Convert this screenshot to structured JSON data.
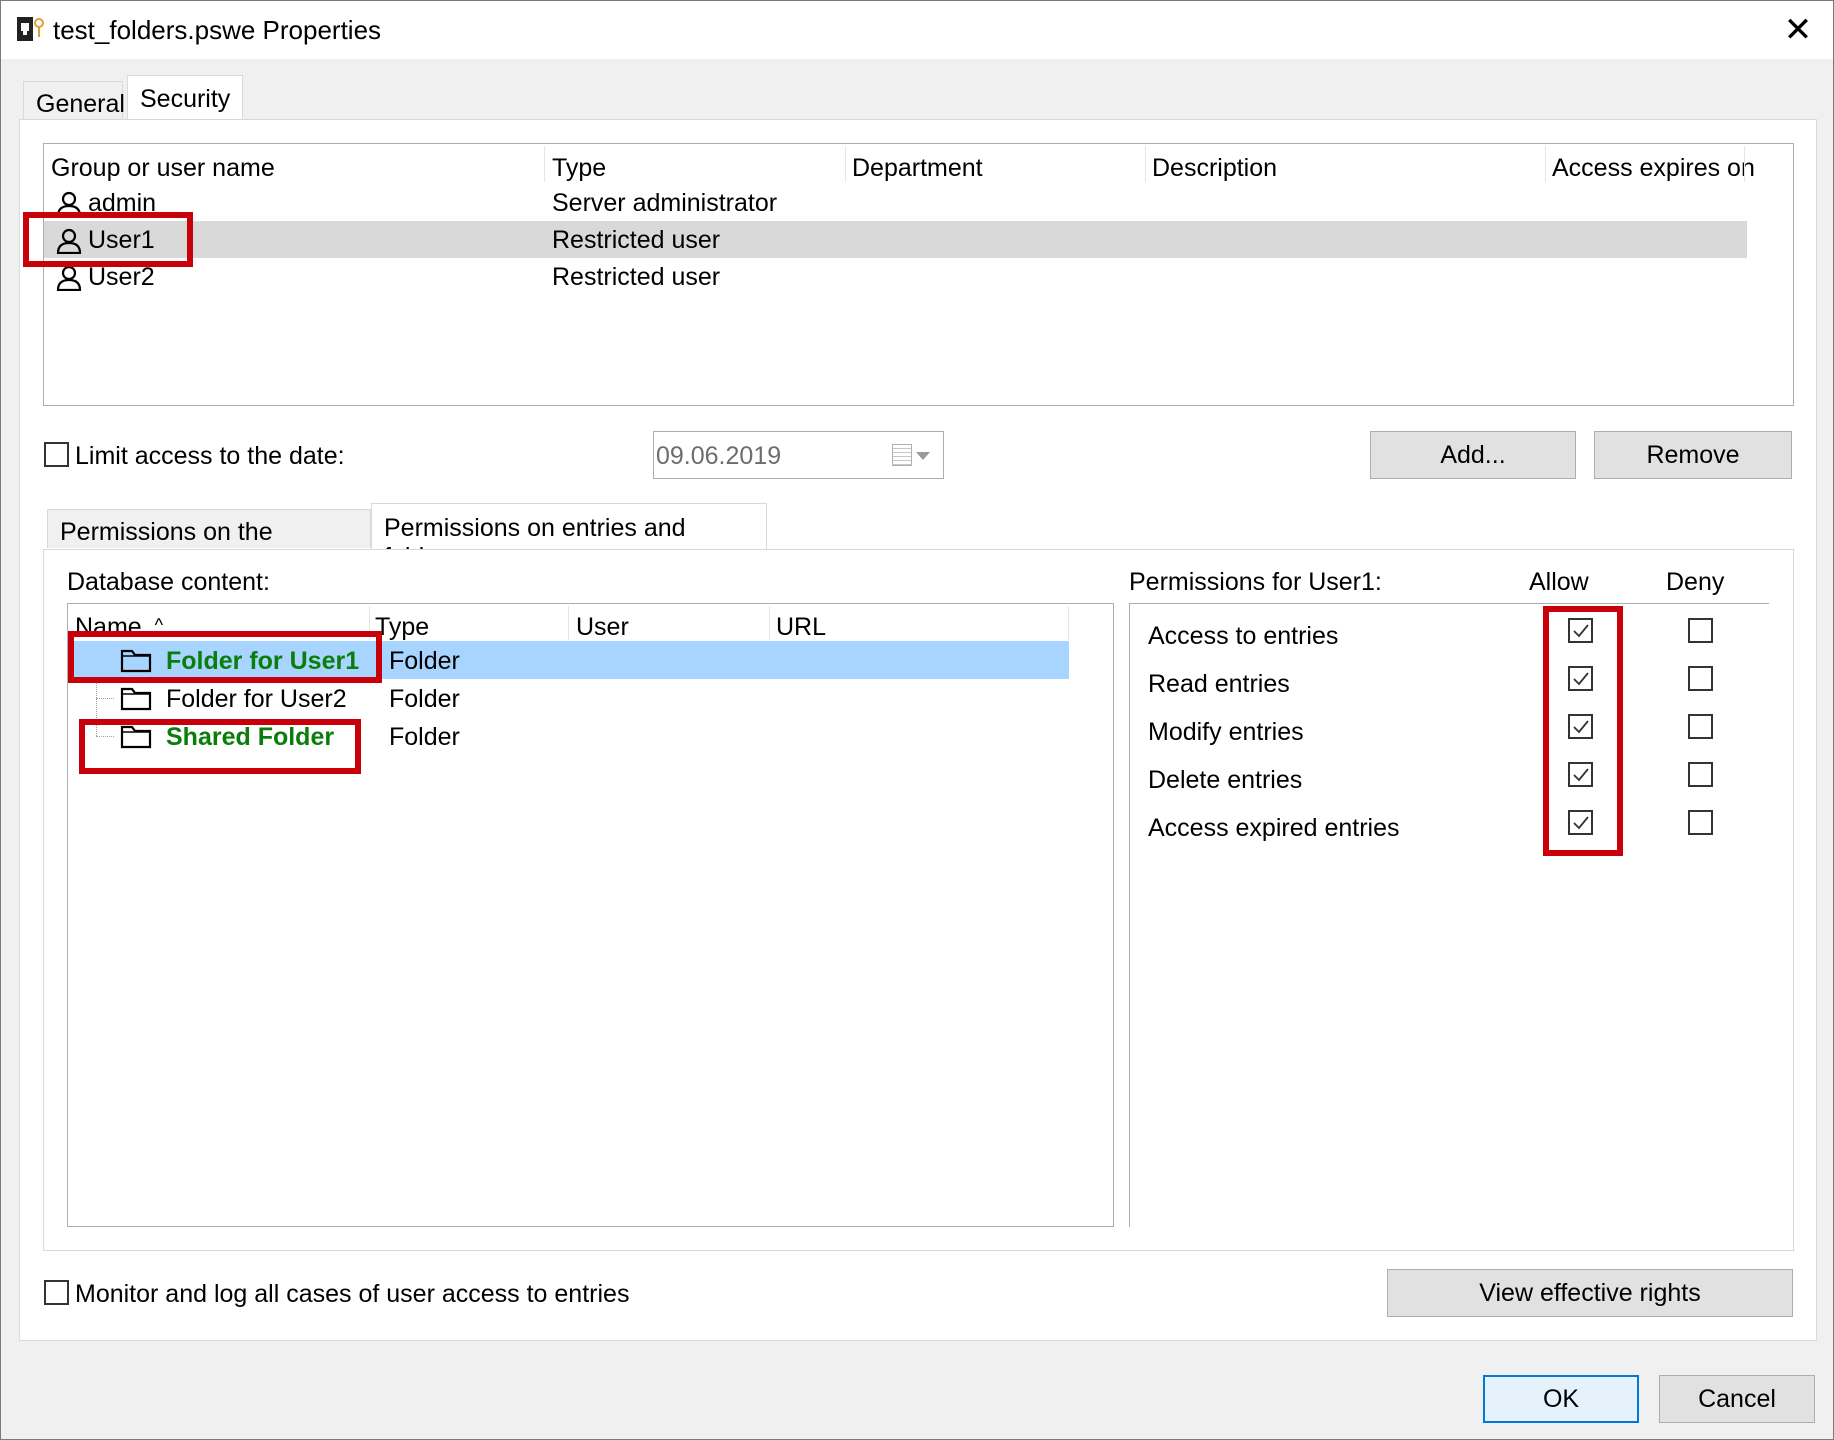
{
  "window": {
    "title": "test_folders.pswe Properties",
    "close_glyph": "✕"
  },
  "tabs": [
    "General",
    "Security"
  ],
  "users_table": {
    "columns": [
      "Group or user name",
      "Type",
      "Department",
      "Description",
      "Access expires on"
    ],
    "rows": [
      {
        "name": "admin",
        "type": "Server administrator",
        "selected": false
      },
      {
        "name": "User1",
        "type": "Restricted user",
        "selected": true
      },
      {
        "name": "User2",
        "type": "Restricted user",
        "selected": false
      }
    ]
  },
  "limit_access": {
    "label": "Limit access to the date:",
    "checked": false,
    "date_value": "09.06.2019"
  },
  "buttons": {
    "add": "Add...",
    "remove": "Remove",
    "view_rights": "View effective rights",
    "ok": "OK",
    "cancel": "Cancel"
  },
  "inner_tabs": [
    "Permissions on the database",
    "Permissions on entries and folders"
  ],
  "database_content": {
    "label": "Database content:",
    "columns": [
      "Name",
      "Type",
      "User",
      "URL"
    ],
    "sort_glyph": "^",
    "rows": [
      {
        "name": "Folder for User1",
        "type": "Folder",
        "highlighted": true,
        "selected": true
      },
      {
        "name": "Folder for User2",
        "type": "Folder",
        "highlighted": false,
        "selected": false
      },
      {
        "name": "Shared Folder",
        "type": "Folder",
        "highlighted": true,
        "selected": false
      }
    ]
  },
  "permissions": {
    "label": "Permissions for User1:",
    "allow_label": "Allow",
    "deny_label": "Deny",
    "rows": [
      {
        "label": "Access to entries",
        "allow": true,
        "deny": false
      },
      {
        "label": "Read entries",
        "allow": true,
        "deny": false
      },
      {
        "label": "Modify entries",
        "allow": true,
        "deny": false
      },
      {
        "label": "Delete entries",
        "allow": true,
        "deny": false
      },
      {
        "label": "Access expired entries",
        "allow": true,
        "deny": false
      }
    ]
  },
  "monitor": {
    "label": "Monitor and log all cases of user access to entries",
    "checked": false
  },
  "colors": {
    "highlight_box": "#c8000a",
    "green_text": "#0a7d0a",
    "selected_row": "#a7d5ff"
  }
}
